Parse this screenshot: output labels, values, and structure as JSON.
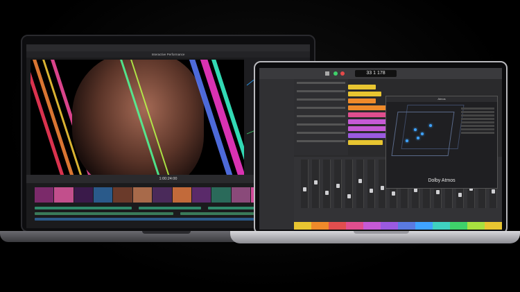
{
  "left_app": {
    "window_title": "Interactive Performance",
    "timecode": "1:00:24:00",
    "timeline_label": "Interactive Performance"
  },
  "right_app": {
    "lcd_display": "33 1 178",
    "panel_title": "Atmos",
    "brand_label": "Dolby Atmos"
  },
  "colors": {
    "accent_blue": "#3fa3ff",
    "region_yellow": "#e8c531",
    "region_orange": "#ef8a2a",
    "region_purple": "#c65ad6",
    "region_pink": "#e04e8e"
  }
}
